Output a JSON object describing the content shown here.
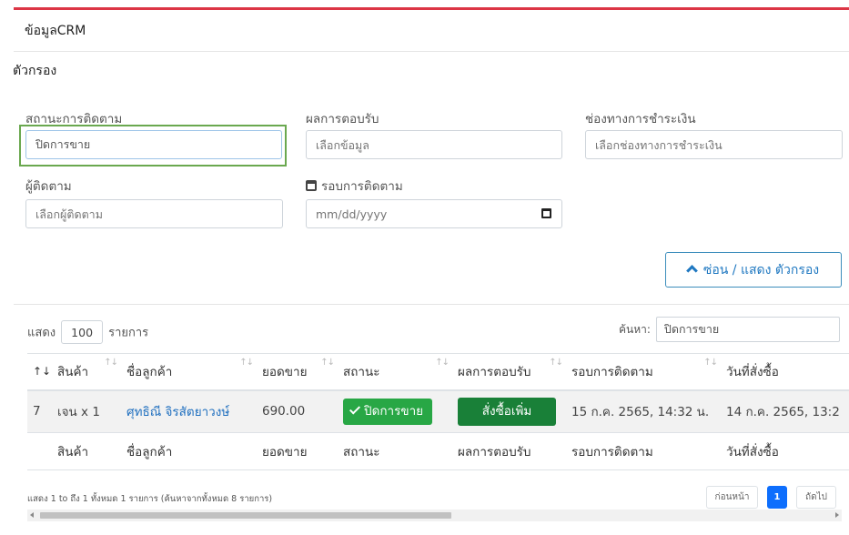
{
  "card_title": "ข้อมูลCRM",
  "filter_title": "ตัวกรอง",
  "filters": {
    "status": {
      "label": "สถานะการติดตาม",
      "value": "ปิดการขาย"
    },
    "result": {
      "label": "ผลการตอบรับ",
      "placeholder": "เลือกข้อมูล"
    },
    "payment": {
      "label": "ช่องทางการชำระเงิน",
      "placeholder": "เลือกช่องทางการชำระเงิน"
    },
    "follower": {
      "label": "ผู้ติดตาม",
      "placeholder": "เลือกผู้ติดตาม"
    },
    "round": {
      "label": "รอบการติดตาม",
      "placeholder": "mm/dd/yyyy",
      "icon": "calendar-icon"
    }
  },
  "toggle_button": "ซ่อน / แสดง ตัวกรอง",
  "table_controls": {
    "show_label": "แสดง",
    "page_length": "100",
    "entries_label": "รายการ",
    "search_label": "ค้นหา:",
    "search_value": "ปิดการขาย"
  },
  "table": {
    "headers": [
      "",
      "สินค้า",
      "ชื่อลูกค้า",
      "ยอดขาย",
      "สถานะ",
      "ผลการตอบรับ",
      "รอบการติดตาม",
      "วันที่สั่งซื้อ"
    ],
    "rows": [
      {
        "index": "7",
        "product": "เจน x 1",
        "customer": "ศุทธิณี จิรสัตยาวงษ์",
        "sales": "690.00",
        "status": "ปิดการขาย",
        "result": "สั่งซื้อเพิ่ม",
        "round": "15 ก.ค. 2565, 14:32 น.",
        "order_date": "14 ก.ค. 2565, 13:2"
      }
    ],
    "footers": [
      "",
      "สินค้า",
      "ชื่อลูกค้า",
      "ยอดขาย",
      "สถานะ",
      "ผลการตอบรับ",
      "รอบการติดตาม",
      "วันที่สั่งซื้อ"
    ]
  },
  "info_text": "แสดง 1 to ถึง 1 ทั้งหมด 1 รายการ (ค้นหาจากทั้งหมด 8 รายการ)",
  "pagination": {
    "prev": "ก่อนหน้า",
    "current": "1",
    "next": "ถัดไป"
  },
  "colors": {
    "accent_top": "#dc3545",
    "status_green": "#28a745",
    "result_green": "#198038",
    "link_blue": "#1f6fbf",
    "highlight": "#6aa84f"
  }
}
